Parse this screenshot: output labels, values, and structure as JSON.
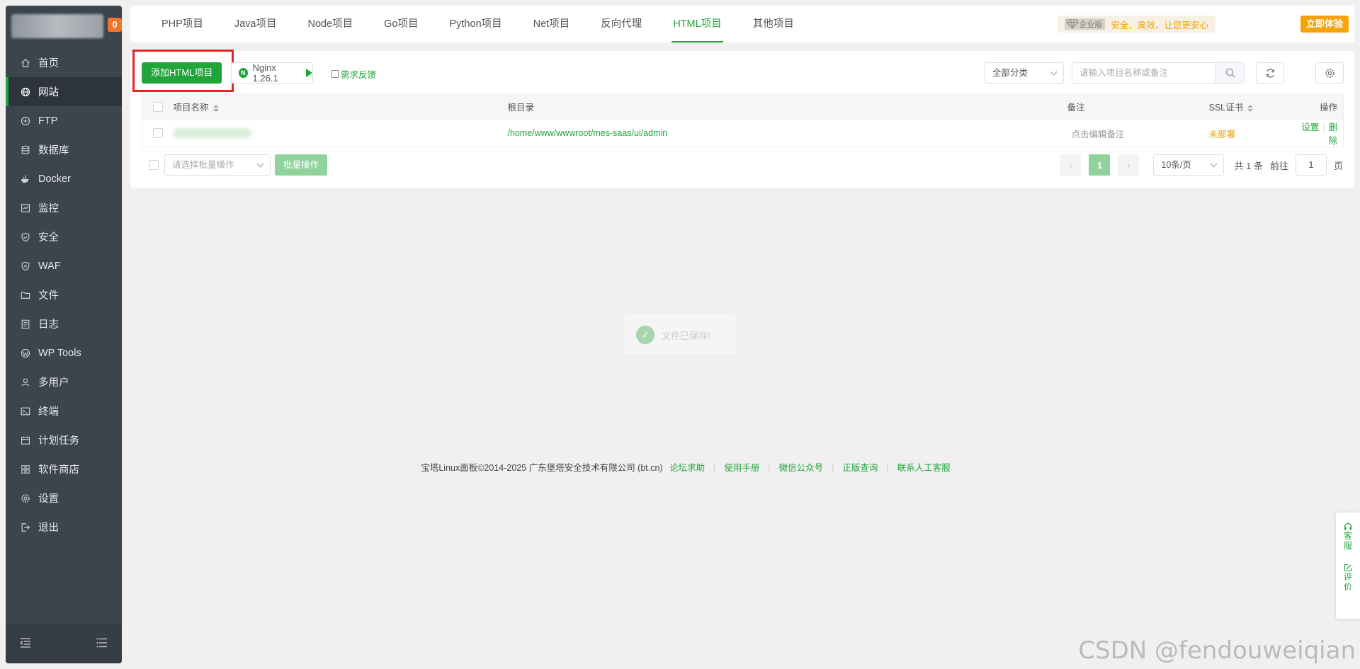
{
  "sidebar": {
    "badge": "0",
    "items": [
      {
        "label": "首页",
        "icon": "home-icon"
      },
      {
        "label": "网站",
        "icon": "globe-icon"
      },
      {
        "label": "FTP",
        "icon": "ftp-icon"
      },
      {
        "label": "数据库",
        "icon": "database-icon"
      },
      {
        "label": "Docker",
        "icon": "docker-icon"
      },
      {
        "label": "监控",
        "icon": "monitor-icon"
      },
      {
        "label": "安全",
        "icon": "shield-icon"
      },
      {
        "label": "WAF",
        "icon": "waf-icon"
      },
      {
        "label": "文件",
        "icon": "folder-icon"
      },
      {
        "label": "日志",
        "icon": "log-icon"
      },
      {
        "label": "WP Tools",
        "icon": "wordpress-icon"
      },
      {
        "label": "多用户",
        "icon": "users-icon"
      },
      {
        "label": "终端",
        "icon": "terminal-icon"
      },
      {
        "label": "计划任务",
        "icon": "calendar-icon"
      },
      {
        "label": "软件商店",
        "icon": "store-icon"
      },
      {
        "label": "设置",
        "icon": "gear-icon"
      },
      {
        "label": "退出",
        "icon": "logout-icon"
      }
    ]
  },
  "tabs": [
    "PHP项目",
    "Java项目",
    "Node项目",
    "Go项目",
    "Python项目",
    "Net项目",
    "反向代理",
    "HTML项目",
    "其他项目"
  ],
  "enterprise": {
    "badge": "企业版",
    "slogan": "安全、高效、让您更安心",
    "cta": "立即体验"
  },
  "toolbar": {
    "add_label": "添加HTML项目",
    "nginx_label": "Nginx 1.26.1",
    "feedback_label": "需求反馈",
    "category_label": "全部分类",
    "search_placeholder": "请输入项目名称或备注"
  },
  "table": {
    "headers": {
      "name": "项目名称",
      "root": "根目录",
      "remark": "备注",
      "ssl": "SSL证书",
      "ops": "操作"
    },
    "rows": [
      {
        "root": "/home/www/wwwroot/mes-saas/ui/admin",
        "remark": "点击编辑备注",
        "ssl": "未部署",
        "op_settings": "设置",
        "op_delete": "删除"
      }
    ]
  },
  "batch": {
    "placeholder": "请选择批量操作",
    "button": "批量操作"
  },
  "pagination": {
    "current": "1",
    "page_size": "10条/页",
    "total_prefix": "共",
    "total": "1",
    "total_suffix": "条",
    "goto_label": "前往",
    "goto_value": "1",
    "page_suffix": "页"
  },
  "toast": {
    "message": "文件已保存!"
  },
  "footer": {
    "copyright": "宝塔Linux面板©2014-2025 广东堡塔安全技术有限公司 (bt.cn)",
    "links": [
      "论坛求助",
      "使用手册",
      "微信公众号",
      "正版查询",
      "联系人工客服"
    ]
  },
  "float_panel": {
    "service": "客服",
    "review": "评价"
  },
  "watermark": "CSDN @fendouweiqian",
  "colors": {
    "brand": "#20a53a",
    "sidebar": "#3c444d",
    "warning": "#f0a000",
    "highlight_box": "#e52521"
  }
}
